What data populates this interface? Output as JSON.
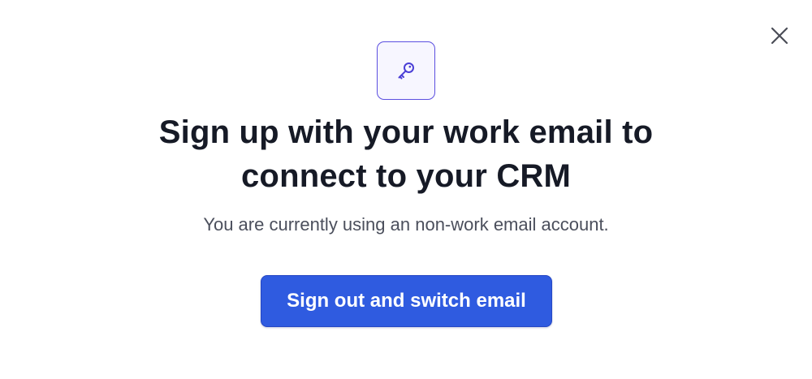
{
  "modal": {
    "title_line1": "Sign up with your work email to",
    "title_line2": "connect to your CRM",
    "subtitle": "You are currently using an non-work email account.",
    "primary_button_label": "Sign out and switch email",
    "header_icon": "key-icon",
    "close_icon": "close-icon"
  },
  "colors": {
    "accent": "#2f5be0",
    "icon_accent": "#5b4fe0",
    "title": "#161a26",
    "subtitle": "#4b4f5c"
  }
}
